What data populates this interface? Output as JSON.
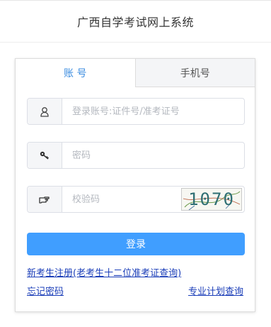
{
  "header": {
    "title": "广西自学考试网上系统"
  },
  "tabs": [
    {
      "label": "账 号",
      "active": true
    },
    {
      "label": "手机号",
      "active": false
    }
  ],
  "form": {
    "account_placeholder": "登录账号:证件号/准考证号",
    "password_placeholder": "密码",
    "captcha_placeholder": "校验码",
    "captcha_text": "1070"
  },
  "login_button": "登录",
  "links": {
    "new_register": "新考生注册(老考生十二位准考证查询)",
    "forgot_password": "忘记密码",
    "major_plan": "专业计划查询"
  },
  "colors": {
    "accent": "#409eff",
    "link": "#1a3db8",
    "tab_active_text": "#3c8de0"
  }
}
